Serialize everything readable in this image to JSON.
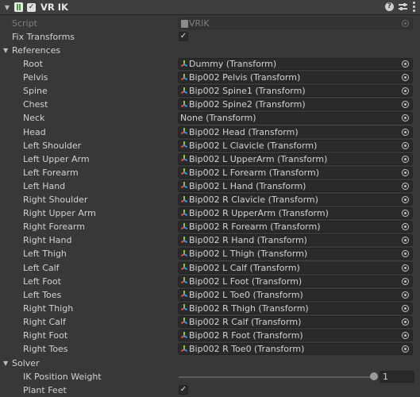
{
  "component": {
    "title": "VR IK",
    "enabled": true,
    "icons": [
      "script-icon",
      "help-icon",
      "preset-sliders-icon",
      "more-options-icon"
    ]
  },
  "script": {
    "label": "Script",
    "value": "VRIK"
  },
  "fix_transforms": {
    "label": "Fix Transforms",
    "checked": true
  },
  "references": {
    "label": "References",
    "items": [
      {
        "label": "Root",
        "value": "Dummy (Transform)",
        "icon": "transform-icon"
      },
      {
        "label": "Pelvis",
        "value": "Bip002 Pelvis (Transform)",
        "icon": "transform-icon"
      },
      {
        "label": "Spine",
        "value": "Bip002 Spine1 (Transform)",
        "icon": "transform-icon"
      },
      {
        "label": "Chest",
        "value": "Bip002 Spine2 (Transform)",
        "icon": "transform-icon"
      },
      {
        "label": "Neck",
        "value": "None (Transform)",
        "icon": ""
      },
      {
        "label": "Head",
        "value": "Bip002 Head (Transform)",
        "icon": "transform-icon"
      },
      {
        "label": "Left Shoulder",
        "value": "Bip002 L Clavicle (Transform)",
        "icon": "transform-icon"
      },
      {
        "label": "Left Upper Arm",
        "value": "Bip002 L UpperArm (Transform)",
        "icon": "transform-icon"
      },
      {
        "label": "Left Forearm",
        "value": "Bip002 L Forearm (Transform)",
        "icon": "transform-icon"
      },
      {
        "label": "Left Hand",
        "value": "Bip002 L Hand (Transform)",
        "icon": "transform-icon"
      },
      {
        "label": "Right Shoulder",
        "value": "Bip002 R Clavicle (Transform)",
        "icon": "transform-icon"
      },
      {
        "label": "Right Upper Arm",
        "value": "Bip002 R UpperArm (Transform)",
        "icon": "transform-icon"
      },
      {
        "label": "Right Forearm",
        "value": "Bip002 R Forearm (Transform)",
        "icon": "transform-icon"
      },
      {
        "label": "Right Hand",
        "value": "Bip002 R Hand (Transform)",
        "icon": "transform-icon"
      },
      {
        "label": "Left Thigh",
        "value": "Bip002 L Thigh (Transform)",
        "icon": "transform-icon"
      },
      {
        "label": "Left Calf",
        "value": "Bip002 L Calf (Transform)",
        "icon": "transform-icon"
      },
      {
        "label": "Left Foot",
        "value": "Bip002 L Foot (Transform)",
        "icon": "transform-icon"
      },
      {
        "label": "Left Toes",
        "value": "Bip002 L Toe0 (Transform)",
        "icon": "transform-icon"
      },
      {
        "label": "Right Thigh",
        "value": "Bip002 R Thigh (Transform)",
        "icon": "transform-icon"
      },
      {
        "label": "Right Calf",
        "value": "Bip002 R Calf (Transform)",
        "icon": "transform-icon"
      },
      {
        "label": "Right Foot",
        "value": "Bip002 R Foot (Transform)",
        "icon": "transform-icon"
      },
      {
        "label": "Right Toes",
        "value": "Bip002 R Toe0 (Transform)",
        "icon": "transform-icon"
      }
    ]
  },
  "solver": {
    "label": "Solver",
    "ik_position_weight": {
      "label": "IK Position Weight",
      "value": "1",
      "fraction": 1.0
    },
    "plant_feet": {
      "label": "Plant Feet",
      "checked": true
    }
  },
  "colors": {
    "background": "#383838",
    "field": "#2a2a2a",
    "text": "#d2d2d2",
    "disabled_text": "#7f7f7f"
  }
}
